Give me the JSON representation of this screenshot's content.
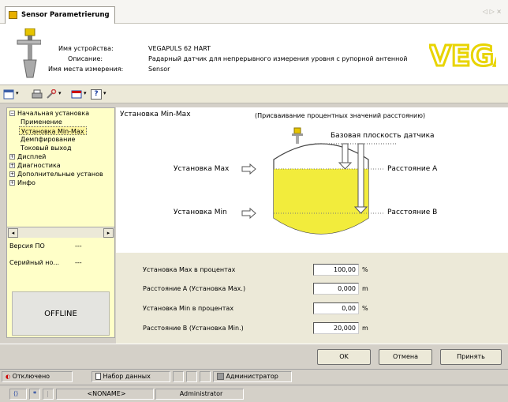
{
  "tab": {
    "title": "Sensor Parametrierung",
    "arrows": "◁ ▷ ×"
  },
  "device": {
    "name_label": "Имя устройства:",
    "name_value": "VEGAPULS 62 HART",
    "desc_label": "Описание:",
    "desc_value": "Радарный датчик для непрерывного измерения уровня с рупорной антенной",
    "place_label": "Имя места измерения:",
    "place_value": "Sensor"
  },
  "logo": {
    "text": "VEGA",
    "color": "#e8d400"
  },
  "toolbar": {
    "help_label": "?"
  },
  "tree": [
    {
      "label": "Начальная установка",
      "toggle": "−",
      "indent": 0
    },
    {
      "label": "Применение",
      "toggle": "",
      "indent": 1
    },
    {
      "label": "Установка Min-Max",
      "toggle": "",
      "indent": 1,
      "selected": true
    },
    {
      "label": "Демпфирование",
      "toggle": "",
      "indent": 1
    },
    {
      "label": "Токовый выход",
      "toggle": "",
      "indent": 1
    },
    {
      "label": "Дисплей",
      "toggle": "+",
      "indent": 0
    },
    {
      "label": "Диагностика",
      "toggle": "+",
      "indent": 0
    },
    {
      "label": "Дополнительные установ",
      "toggle": "+",
      "indent": 0
    },
    {
      "label": "Инфо",
      "toggle": "+",
      "indent": 0
    }
  ],
  "info": {
    "version_label": "Версия ПО",
    "version_value": "---",
    "serial_label": "Серийный но...",
    "serial_value": "---",
    "offline": "OFFLINE"
  },
  "diagram": {
    "title": "Установка Min-Max",
    "note": "(Присваивание процентных значений расстоянию)",
    "base_plane": "Базовая плоскость датчика",
    "max_label": "Установка Max",
    "min_label": "Установка Min",
    "dist_a": "Расстояние A",
    "dist_b": "Расстояние B"
  },
  "form": [
    {
      "label": "Установка Max в процентах",
      "value": "100,00",
      "unit": "%"
    },
    {
      "label": "Расстояние A (Установка Max.)",
      "value": "0,000",
      "unit": "m"
    },
    {
      "label": "Установка Min в процентах",
      "value": "0,00",
      "unit": "%"
    },
    {
      "label": "Расстояние B (Установка Min.)",
      "value": "20,000",
      "unit": "m"
    }
  ],
  "buttons": {
    "ok": "OK",
    "cancel": "Отмена",
    "apply": "Принять"
  },
  "status": {
    "disconnected": "Отключено",
    "dataset": "Набор данных",
    "admin": "Администратор"
  },
  "status2": {
    "noname": "<NONAME>",
    "user": "Administrator",
    "star": "*"
  },
  "colors": {
    "tree_bg": "#ffffc8",
    "liquid": "#f2ec3c",
    "accent": "#e8d400"
  }
}
